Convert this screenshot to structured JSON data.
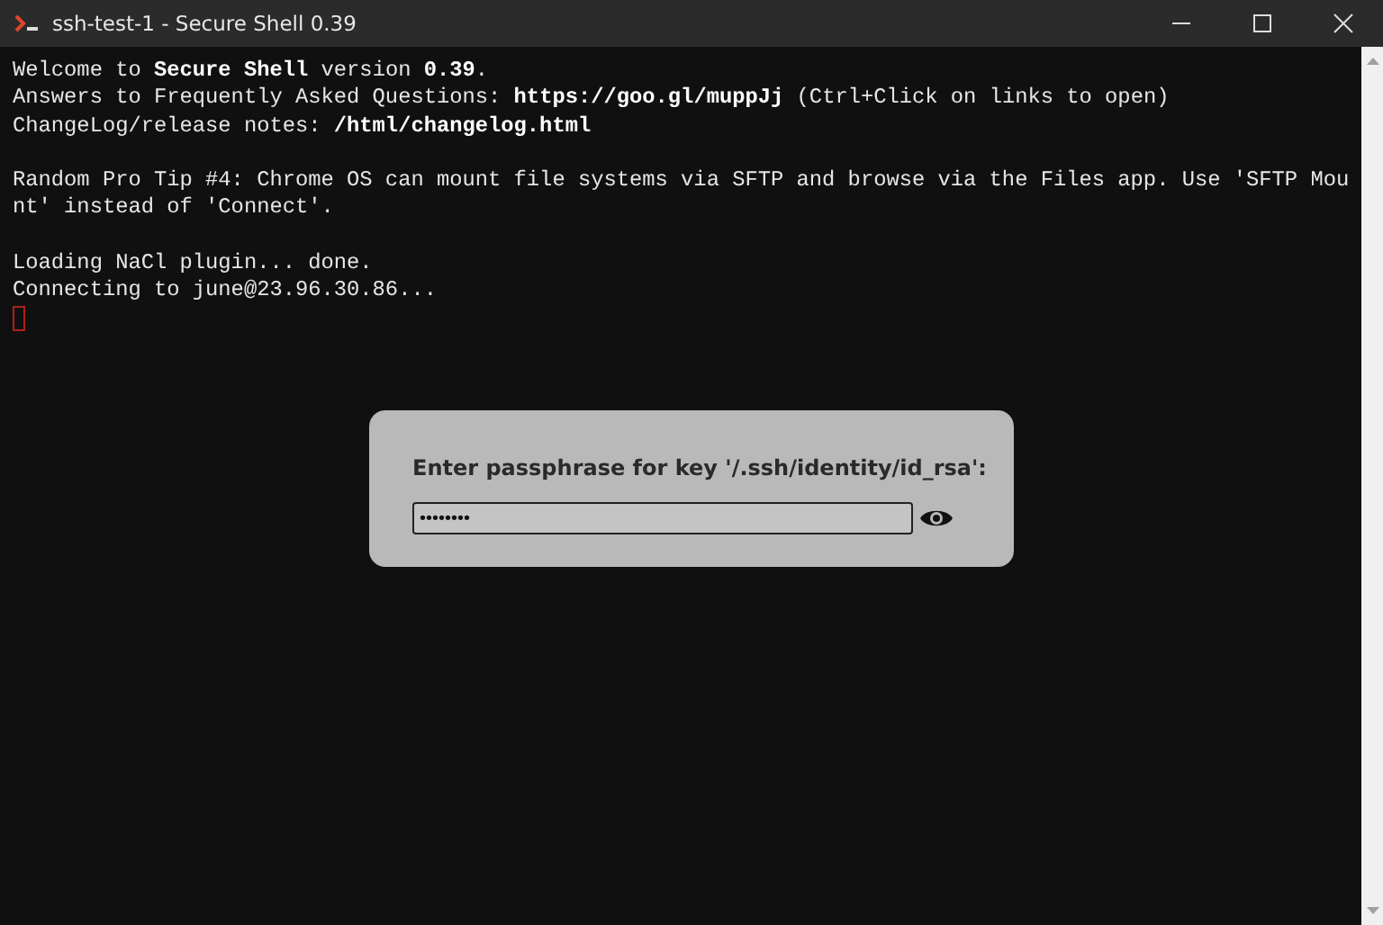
{
  "window": {
    "title": "ssh-test-1 - Secure Shell 0.39"
  },
  "terminal": {
    "blocks": [
      [
        "Welcome to **Secure Shell** version **0.39**.",
        "Answers to Frequently Asked Questions: **https://goo.gl/muppJj** (Ctrl+Click on links to open)",
        "ChangeLog/release notes: **/html/changelog.html**"
      ],
      [
        "Random Pro Tip #4: Chrome OS can mount file systems via SFTP and browse via the Files app. Use 'SFTP Mou",
        "nt' instead of 'Connect'."
      ],
      [
        "Loading NaCl plugin... done.",
        "Connecting to june@23.96.30.86..."
      ]
    ],
    "cursor": true
  },
  "dialog": {
    "prompt": "Enter passphrase for key '/.ssh/identity/id_rsa':",
    "value": "••••••••"
  }
}
